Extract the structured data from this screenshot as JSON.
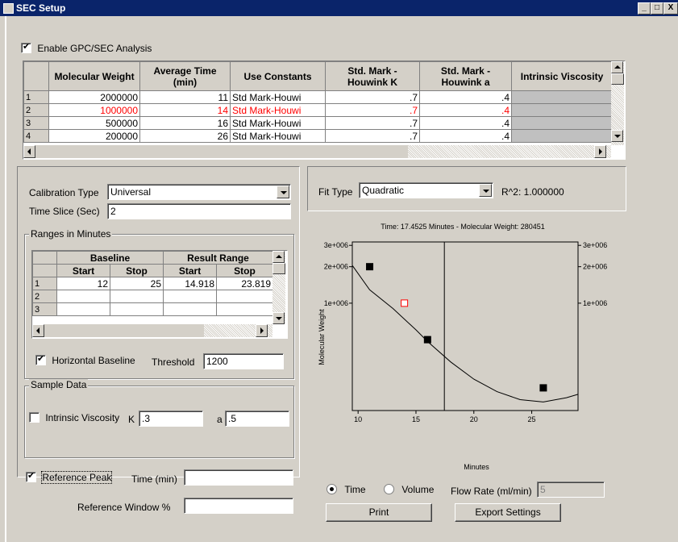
{
  "window": {
    "title": "SEC Setup",
    "min_label": "_",
    "max_label": "□",
    "close_label": "X"
  },
  "enable_gpc": {
    "label": "Enable GPC/SEC Analysis",
    "checked": true
  },
  "cal_table": {
    "headers": [
      "Molecular Weight",
      "Average Time (min)",
      "Use Constants",
      "Std. Mark - Houwink K",
      "Std. Mark - Houwink a",
      "Intrinsic Viscosity"
    ],
    "rows": [
      {
        "n": "1",
        "mw": "2000000",
        "time": "11",
        "const": "Std Mark-Houwi",
        "k": ".7",
        "a": ".4",
        "iv": "",
        "red": false
      },
      {
        "n": "2",
        "mw": "1000000",
        "time": "14",
        "const": "Std Mark-Houwi",
        "k": ".7",
        "a": ".4",
        "iv": "",
        "red": true
      },
      {
        "n": "3",
        "mw": "500000",
        "time": "16",
        "const": "Std Mark-Houwi",
        "k": ".7",
        "a": ".4",
        "iv": "",
        "red": false
      },
      {
        "n": "4",
        "mw": "200000",
        "time": "26",
        "const": "Std Mark-Houwi",
        "k": ".7",
        "a": ".4",
        "iv": "",
        "red": false
      }
    ]
  },
  "calibration_type": {
    "label": "Calibration Type",
    "value": "Universal"
  },
  "time_slice": {
    "label": "Time Slice (Sec)",
    "value": "2"
  },
  "ranges": {
    "title": "Ranges in Minutes",
    "group_headers": [
      "Baseline",
      "Result Range"
    ],
    "headers": [
      "Start",
      "Stop",
      "Start",
      "Stop"
    ],
    "rows": [
      {
        "n": "1",
        "b_start": "12",
        "b_stop": "25",
        "r_start": "14.918",
        "r_stop": "23.819"
      },
      {
        "n": "2",
        "b_start": "",
        "b_stop": "",
        "r_start": "",
        "r_stop": ""
      },
      {
        "n": "3",
        "b_start": "",
        "b_stop": "",
        "r_start": "",
        "r_stop": ""
      }
    ],
    "horizontal_baseline": {
      "label": "Horizontal Baseline",
      "checked": true
    },
    "threshold": {
      "label": "Threshold",
      "value": "1200"
    }
  },
  "sample_data": {
    "title": "Sample Data",
    "intrinsic_viscosity": {
      "label": "Intrinsic Viscosity",
      "checked": false
    },
    "k": {
      "label": "K",
      "value": ".3"
    },
    "a": {
      "label": "a",
      "value": ".5"
    }
  },
  "reference": {
    "peak_label": "Reference Peak",
    "peak_checked": true,
    "time_label": "Time (min)",
    "time_value": "",
    "window_label": "Reference Window %",
    "window_value": ""
  },
  "fit": {
    "label": "Fit Type",
    "value": "Quadratic",
    "r2": "R^2: 1.000000"
  },
  "chart_data": {
    "type": "scatter",
    "title": "Time:  17.4525 Minutes - Molecular Weight:  280451",
    "xlabel": "Minutes",
    "ylabel": "Molecular Weight",
    "xlim": [
      9.5,
      29
    ],
    "ylim_log": [
      130000,
      3200000
    ],
    "y_scale": "log",
    "xticks": [
      "10",
      "15",
      "20",
      "25"
    ],
    "xtick_values": [
      10,
      15,
      20,
      25
    ],
    "yticks": [
      "3e+006",
      "2e+006",
      "1e+006"
    ],
    "ytick_values": [
      3000000,
      2000000,
      1000000
    ],
    "points": [
      {
        "x": 11,
        "y": 2000000,
        "style": "filled"
      },
      {
        "x": 14,
        "y": 1000000,
        "style": "hollow-red"
      },
      {
        "x": 16,
        "y": 500000,
        "style": "filled"
      },
      {
        "x": 26,
        "y": 200000,
        "style": "filled"
      }
    ],
    "cursor_x": 17.4525,
    "curve": {
      "x": [
        9.5,
        11,
        13,
        15,
        16,
        18,
        20,
        22,
        24,
        26,
        28,
        29
      ],
      "y": [
        2050000,
        1290000,
        905000,
        602000,
        483000,
        327000,
        236000,
        186000,
        160000,
        153000,
        166000,
        177000
      ]
    }
  },
  "mode": {
    "time_label": "Time",
    "volume_label": "Volume",
    "selected": "time"
  },
  "flow_rate": {
    "label": "Flow Rate (ml/min)",
    "value": "5"
  },
  "buttons": {
    "print": "Print",
    "export": "Export Settings"
  }
}
